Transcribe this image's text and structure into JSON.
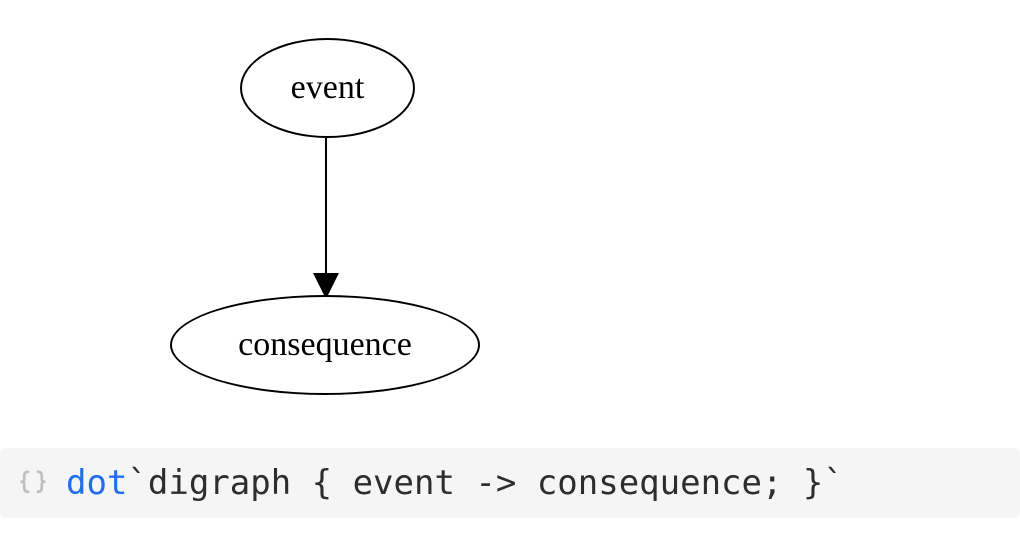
{
  "diagram": {
    "nodes": {
      "event": {
        "label": "event"
      },
      "consequence": {
        "label": "consequence"
      }
    },
    "edges": [
      {
        "from": "event",
        "to": "consequence"
      }
    ]
  },
  "code": {
    "keyword": "dot",
    "body": "`digraph { event -> consequence; }`"
  },
  "chart_data": {
    "type": "directed-graph",
    "nodes": [
      "event",
      "consequence"
    ],
    "edges": [
      {
        "from": "event",
        "to": "consequence"
      }
    ],
    "source_language": "dot",
    "source": "digraph { event -> consequence; }"
  }
}
